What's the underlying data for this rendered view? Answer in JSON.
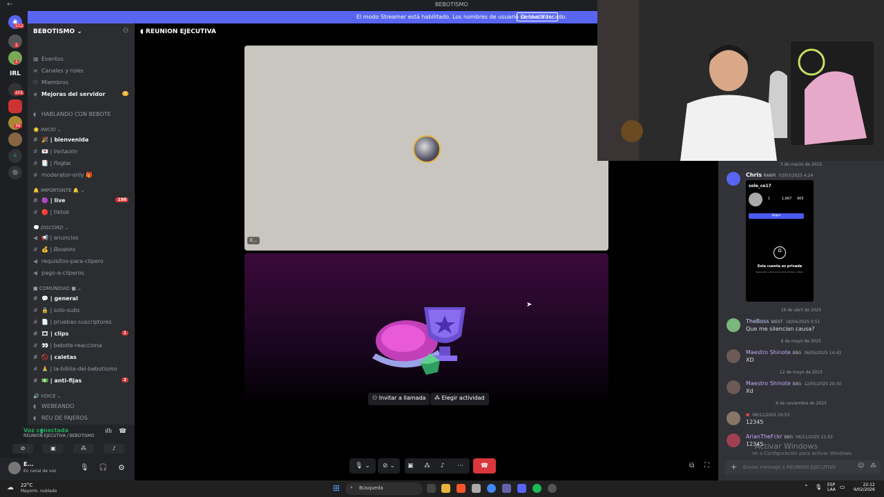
{
  "window": {
    "title": "BEBOTISMO",
    "nav_back": "←"
  },
  "banner": {
    "text": "El modo Streamer está habilitado. Los nombres de usuario se han truncado.",
    "button": "Deshabilitar"
  },
  "guilds": {
    "badges": [
      "512",
      "1",
      "2",
      "201",
      "36"
    ],
    "irl_label": "IRL"
  },
  "sidebar": {
    "server_name": "BEBOTISMO",
    "top_items": [
      {
        "label": "Eventos"
      },
      {
        "label": "Canales y roles"
      },
      {
        "label": "Miembros"
      },
      {
        "label": "Mejoras del servidor"
      }
    ],
    "hablando": "HABLANDO CON BEBOTE",
    "categories": {
      "inicio": "INICIO",
      "importante": "IMPORTANTE",
      "discord": "DISCORD",
      "comunidad": "COMUNIDAD",
      "voice": "VOICE"
    },
    "channels": {
      "bienvenida": "| bienvenida",
      "invitacion": "| 𝐼𝑛𝑣𝑖𝑡𝑎𝑐𝑖𝑜́𝑛",
      "reglas": "| 𝑅𝑒𝑔𝑙𝑎𝑠",
      "moderator_only": "moderator-only",
      "live": "| live",
      "live_badge": "198",
      "tiktok": "| tiktok",
      "anuncios": "| anuncios",
      "boosters": "| 𝐵𝑜𝑜𝑠𝑡𝑒𝑟𝑠",
      "requisitos": "requisitos-para-clipero",
      "pago": "pago-a-cliperos",
      "general": "| general",
      "solo_subs": "| solo-subs",
      "pruebas": "| pruebas-suscriptores",
      "clips": "| clips",
      "clips_badge": "1",
      "reacciona": "| bebote-reacciona",
      "caletas": "| caletas",
      "biblia": "| la-biblia-del-bebotismo",
      "anti_fijas": "| anti-fijas",
      "anti_fijas_badge": "2",
      "webeando": "WEBEANDO",
      "reu_pajeros": "REU DE PAJEROS"
    }
  },
  "voice": {
    "status": "Voz conectada",
    "channel": "REUNION EJECUTIVA / BEBOTISMO"
  },
  "user": {
    "name": "E...",
    "status": "En canal de voz"
  },
  "main": {
    "header": "REUNION EJECUTIVA",
    "tile_label": "E...",
    "invite_button": "Invitar a llamada",
    "activity_button": "Elegir actividad"
  },
  "chat": {
    "messages": [
      {
        "date": "3 de marzo de 2025",
        "author": "Chris",
        "tag": "RAWR",
        "time": "03/03/2025 4:24",
        "text": "",
        "author_color": "#ffffff",
        "avatar_color": "#5865f2"
      },
      {
        "date": "18 de abril de 2025",
        "author": "TheBoss",
        "tag": "WEST",
        "time": "18/04/2025 0:51",
        "text": "Que me silencian causa?",
        "author_color": "#c9cdfb",
        "avatar_color": "#7ab87a"
      },
      {
        "date": "6 de mayo de 2025",
        "author": "Maestro Shinote",
        "tag": "BBG",
        "time": "06/05/2025 14:43",
        "text": "XD",
        "author_color": "#c9a6fb",
        "avatar_color": "#6b5a55"
      },
      {
        "date": "12 de mayo de 2025",
        "author": "Maestro Shinote",
        "tag": "BBG",
        "time": "12/05/2025 20:30",
        "text": "Xd",
        "author_color": "#c9a6fb",
        "avatar_color": "#6b5a55"
      },
      {
        "date": "6 de noviembre de 2025",
        "author": "",
        "tag": "",
        "time": "06/11/2025 20:53",
        "text": "12345",
        "author_color": "#e04848",
        "avatar_color": "#887766"
      },
      {
        "date": "",
        "author": "ArianTheFckr",
        "tag": "BBG",
        "time": "06/11/2025 21:53",
        "text": "12345",
        "author_color": "#c9a6fb",
        "avatar_color": "#a04050"
      }
    ],
    "embed": {
      "username": "sole_ce17",
      "private_title": "Esta cuenta es privada",
      "private_sub": "Sigue esta cuenta para ver sus fotos y videos.",
      "follow": "Seguir",
      "stats": [
        "1",
        "1,667",
        "905"
      ]
    },
    "input_placeholder": "Enviar mensaje a REUNION EJECUTIVA",
    "activate_title": "Activar Windows",
    "activate_sub": "Ve a Configuración para activar Windows."
  },
  "taskbar": {
    "weather_temp": "22°C",
    "weather_desc": "Mayorm. nublado",
    "search": "Búsqueda",
    "lang1": "ESP",
    "lang2": "LAA",
    "time": "22:12",
    "date": "9/02/2026"
  },
  "colors": {
    "accent": "#5865f2",
    "danger": "#da373c",
    "online": "#23a55a"
  }
}
